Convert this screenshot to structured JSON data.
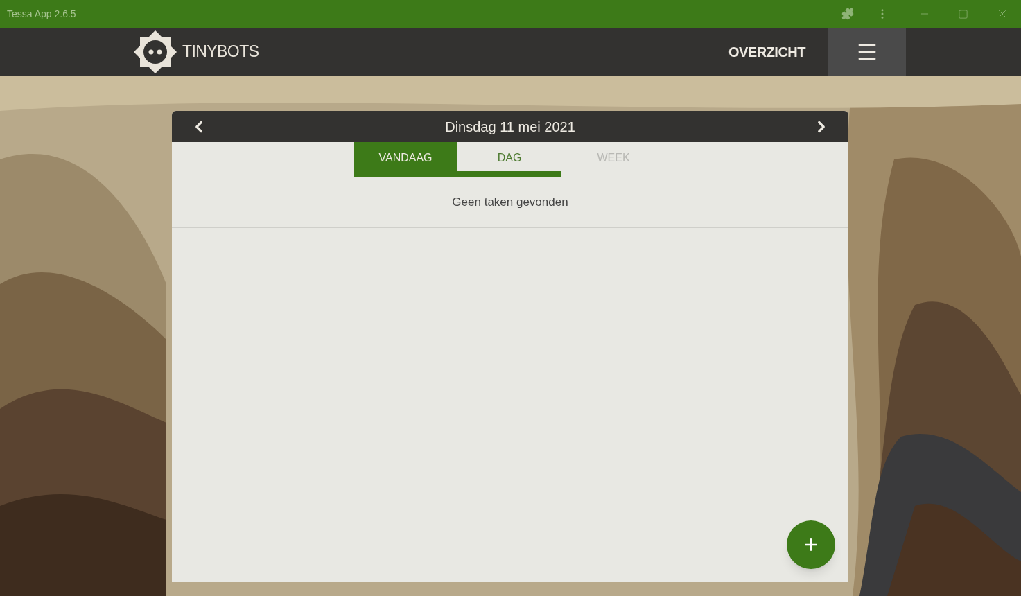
{
  "window": {
    "title": "Tessa App 2.6.5"
  },
  "header": {
    "brand": "TINYBOTS",
    "nav_label": "OVERZICHT",
    "menu_active": true
  },
  "calendar": {
    "date": "Dinsdag 11 mei 2021",
    "tabs": [
      {
        "label": "VANDAAG",
        "selected": true,
        "disabled": false
      },
      {
        "label": "DAG",
        "selected": false,
        "disabled": false
      },
      {
        "label": "WEEK",
        "selected": false,
        "disabled": true
      }
    ],
    "empty_message": "Geen taken gevonden"
  }
}
